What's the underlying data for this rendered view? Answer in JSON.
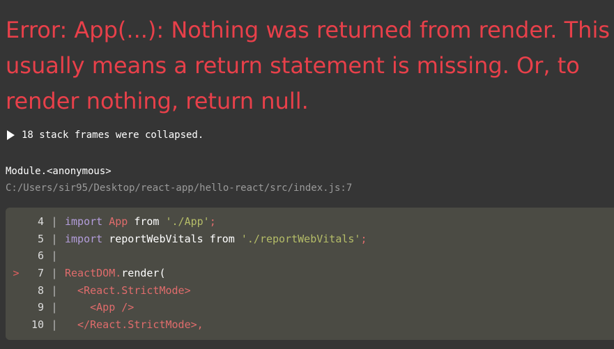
{
  "error": {
    "message": "Error: App(...): Nothing was returned from render. This usually means a return statement is missing. Or, to render nothing, return null."
  },
  "stack": {
    "collapsed_label": "18 stack frames were collapsed."
  },
  "frame": {
    "function": "Module.<anonymous>",
    "location": "C:/Users/sir95/Desktop/react-app/hello-react/src/index.js:7"
  },
  "code": {
    "lines": [
      {
        "num": "4",
        "marker": "",
        "tokens": [
          [
            "kw",
            "import "
          ],
          [
            "rd",
            "App "
          ],
          [
            "wh",
            "from "
          ],
          [
            "st",
            "'./App'"
          ],
          [
            "rd",
            ";"
          ]
        ]
      },
      {
        "num": "5",
        "marker": "",
        "tokens": [
          [
            "kw",
            "import "
          ],
          [
            "wh",
            "reportWebVitals from "
          ],
          [
            "st",
            "'./reportWebVitals'"
          ],
          [
            "rd",
            ";"
          ]
        ]
      },
      {
        "num": "6",
        "marker": "",
        "tokens": []
      },
      {
        "num": "7",
        "marker": ">",
        "tokens": [
          [
            "rd",
            "ReactDOM."
          ],
          [
            "wh",
            "render("
          ]
        ]
      },
      {
        "num": "8",
        "marker": "",
        "tokens": [
          [
            "rd",
            "  <React.StrictMode>"
          ]
        ]
      },
      {
        "num": "9",
        "marker": "",
        "tokens": [
          [
            "rd",
            "    <App />"
          ]
        ]
      },
      {
        "num": "10",
        "marker": "",
        "tokens": [
          [
            "rd",
            "  </React.StrictMode>,"
          ]
        ]
      }
    ]
  }
}
